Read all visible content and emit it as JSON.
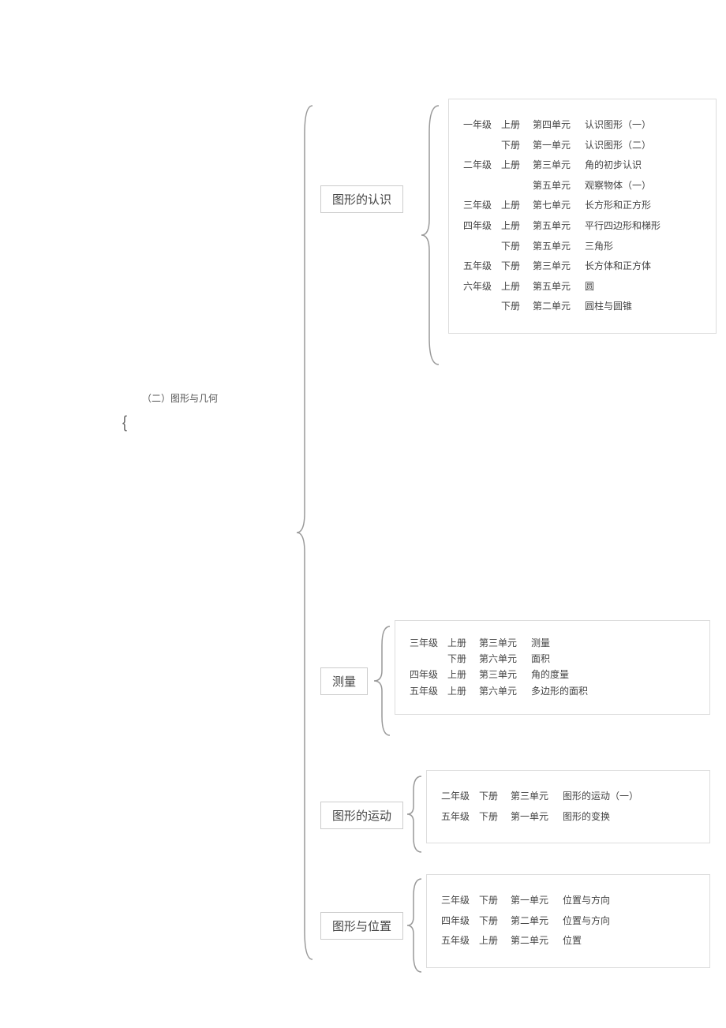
{
  "root": {
    "label": "（二）图形与几何"
  },
  "section1": {
    "title": "图形的认识",
    "rows": [
      {
        "grade": "一年级",
        "vol": "上册",
        "unit": "第四单元",
        "topic": "认识图形（一）"
      },
      {
        "grade": "",
        "vol": "下册",
        "unit": "第一单元",
        "topic": "认识图形（二）"
      },
      {
        "grade": "二年级",
        "vol": "上册",
        "unit": "第三单元",
        "topic": "角的初步认识"
      },
      {
        "grade": "",
        "vol": "",
        "unit": "第五单元",
        "topic": "观察物体（一）"
      },
      {
        "grade": "三年级",
        "vol": "上册",
        "unit": "第七单元",
        "topic": "长方形和正方形"
      },
      {
        "grade": "四年级",
        "vol": "上册",
        "unit": "第五单元",
        "topic": "平行四边形和梯形"
      },
      {
        "grade": "",
        "vol": "下册",
        "unit": "第五单元",
        "topic": "三角形"
      },
      {
        "grade": "五年级",
        "vol": "下册",
        "unit": "第三单元",
        "topic": "长方体和正方体"
      },
      {
        "grade": "六年级",
        "vol": "上册",
        "unit": "第五单元",
        "topic": "圆"
      },
      {
        "grade": "",
        "vol": "下册",
        "unit": "第二单元",
        "topic": "圆柱与圆锥"
      }
    ]
  },
  "section2": {
    "title": "测量",
    "rows": [
      {
        "grade": "三年级",
        "vol": "上册",
        "unit": "第三单元",
        "topic": "测量"
      },
      {
        "grade": "",
        "vol": "下册",
        "unit": "第六单元",
        "topic": "面积"
      },
      {
        "grade": "四年级",
        "vol": "上册",
        "unit": "第三单元",
        "topic": "角的度量"
      },
      {
        "grade": "五年级",
        "vol": "上册",
        "unit": "第六单元",
        "topic": "多边形的面积"
      }
    ]
  },
  "section3": {
    "title": "图形的运动",
    "rows": [
      {
        "grade": "二年级",
        "vol": "下册",
        "unit": "第三单元",
        "topic": "图形的运动（一）"
      },
      {
        "grade": "五年级",
        "vol": "下册",
        "unit": "第一单元",
        "topic": "图形的变换"
      }
    ]
  },
  "section4": {
    "title": "图形与位置",
    "rows": [
      {
        "grade": "三年级",
        "vol": "下册",
        "unit": "第一单元",
        "topic": "位置与方向"
      },
      {
        "grade": "四年级",
        "vol": "下册",
        "unit": "第二单元",
        "topic": "位置与方向"
      },
      {
        "grade": "五年级",
        "vol": "上册",
        "unit": "第二单元",
        "topic": "位置"
      }
    ]
  }
}
